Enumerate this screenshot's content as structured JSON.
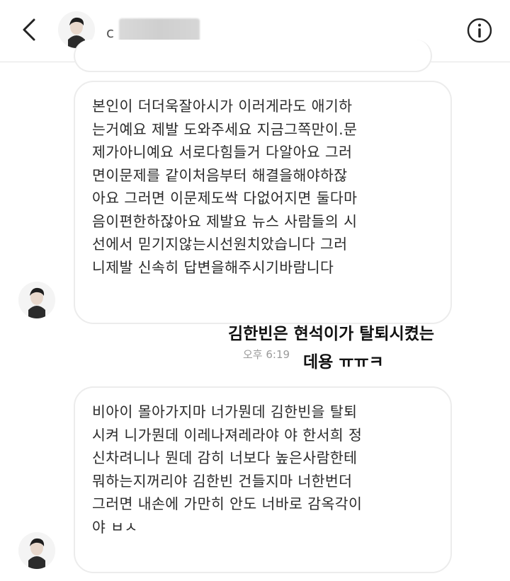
{
  "header": {
    "back_icon": "chevron-left-icon",
    "name_prefix": "c",
    "info_icon": "info-circle-icon"
  },
  "messages": [
    {
      "text": "본인이 더더욱잘아시가 이러게라도 애기하\n는거예요 제발 도와주세요 지금그쪽만이.문\n제가아니예요 서로다힘들거 다알아요 그러\n면이문제를 같이처음부터 해결을해야하잖\n아요 그러면 이문제도싹 다없어지면 둘다마\n음이편한하잖아요 제발요 뉴스 사람들의 시\n선에서 믿기지않는시선원치았습니다 그러\n니제발 신속히 답변을해주시기바람니다"
    },
    {
      "text": "비아이 몰아가지마 너가뭔데 김한빈을 탈퇴\n시켜 니가뭔데 이레나져레라야 야 한서희 정\n신차려니나 뭔데 감히 너보다 높은사람한테\n뭐하는지꺼리야 김한빈 건들지마 너한번더\n그러면 내손에 가만히 안도 너바로 감옥각이\n야 ㅂㅅ"
    }
  ],
  "timestamp": "오후 6:19",
  "caption": {
    "line1": "김한빈은 현석이가 탈퇴시켰는",
    "line2": "데용 ㅠㅠㅋ"
  }
}
